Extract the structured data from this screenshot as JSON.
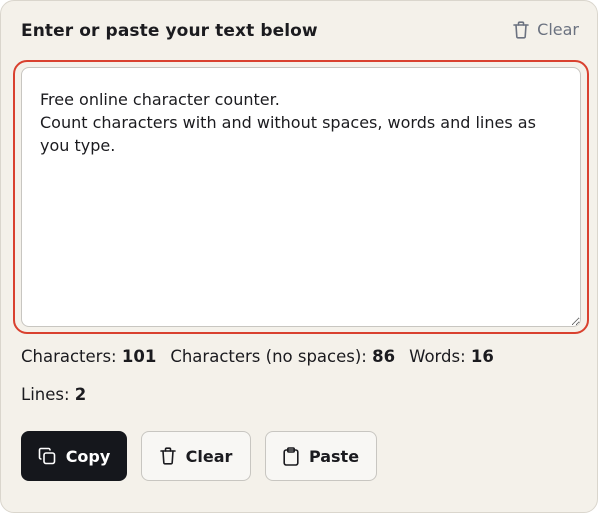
{
  "header": {
    "title": "Enter or paste your text below",
    "clear_label": "Clear",
    "clear_icon": "trash-icon"
  },
  "editor": {
    "text": "Free online character counter.\nCount characters with and without spaces, words and lines as you type."
  },
  "stats": {
    "characters_label": "Characters:",
    "characters_value": "101",
    "characters_no_spaces_label": "Characters (no spaces):",
    "characters_no_spaces_value": "86",
    "words_label": "Words:",
    "words_value": "16",
    "lines_label": "Lines:",
    "lines_value": "2"
  },
  "actions": {
    "copy_label": "Copy",
    "copy_icon": "copy-icon",
    "clear_label": "Clear",
    "clear_icon": "trash-icon",
    "paste_label": "Paste",
    "paste_icon": "clipboard-icon"
  },
  "colors": {
    "card_background": "#f4f1ea",
    "focus_ring": "#d9412f",
    "primary_button": "#15171c"
  }
}
